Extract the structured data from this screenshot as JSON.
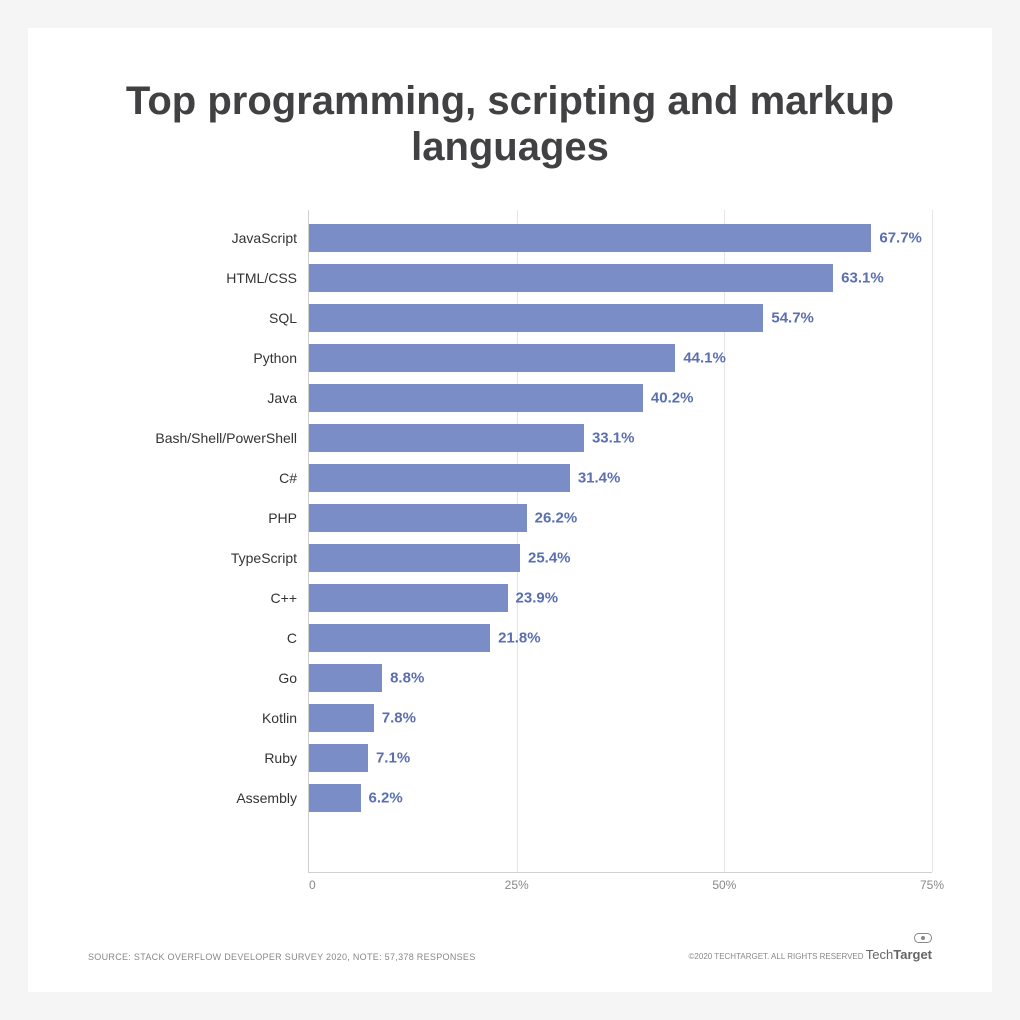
{
  "chart_data": {
    "type": "bar",
    "title": "Top programming, scripting and markup languages",
    "categories": [
      "JavaScript",
      "HTML/CSS",
      "SQL",
      "Python",
      "Java",
      "Bash/Shell/PowerShell",
      "C#",
      "PHP",
      "TypeScript",
      "C++",
      "C",
      "Go",
      "Kotlin",
      "Ruby",
      "Assembly"
    ],
    "values": [
      67.7,
      63.1,
      54.7,
      44.1,
      40.2,
      33.1,
      31.4,
      26.2,
      25.4,
      23.9,
      21.8,
      8.8,
      7.8,
      7.1,
      6.2
    ],
    "xlabel": "",
    "ylabel": "",
    "xlim": [
      0,
      75
    ],
    "ticks": [
      0,
      25,
      50,
      75
    ],
    "tick_labels": [
      "0",
      "25%",
      "50%",
      "75%"
    ],
    "bar_color": "#7b8dc7",
    "value_color": "#5a6fb0"
  },
  "footer": {
    "source": "SOURCE: STACK OVERFLOW DEVELOPER SURVEY 2020, NOTE: 57,378 RESPONSES",
    "copyright": "©2020 TECHTARGET. ALL RIGHTS RESERVED",
    "logo_light": "Tech",
    "logo_bold": "Target"
  }
}
